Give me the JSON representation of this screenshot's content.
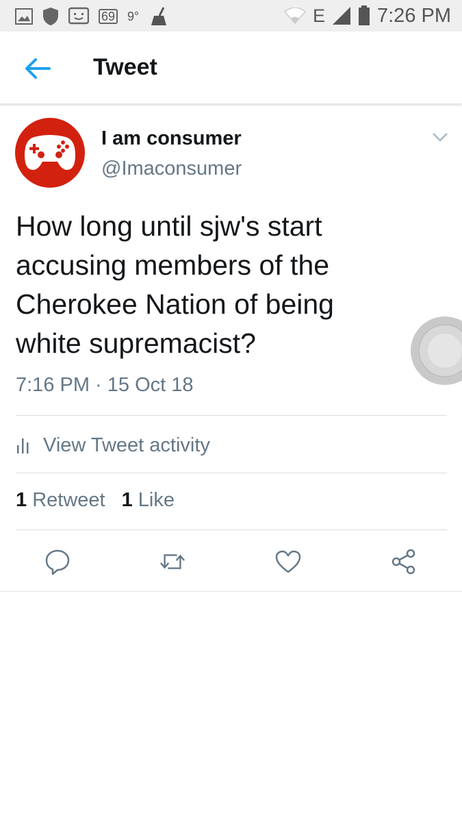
{
  "status_bar": {
    "badge_number": "69",
    "temperature": "9°",
    "network_label": "E",
    "time": "7:26 PM"
  },
  "app_bar": {
    "title": "Tweet"
  },
  "tweet": {
    "display_name": "I am consumer",
    "handle": "@Imaconsumer",
    "text": "How long until sjw's start\naccusing members of the\nCherokee Nation of being\nwhite supremacist?",
    "timestamp": "7:16 PM · 15 Oct 18",
    "activity_label": "View Tweet activity",
    "retweet_count": "1",
    "retweet_label": "Retweet",
    "like_count": "1",
    "like_label": "Like"
  },
  "icons": {
    "back": "back-arrow-icon",
    "caret": "chevron-down-icon",
    "activity": "bar-chart-icon",
    "reply": "reply-icon",
    "retweet": "retweet-icon",
    "like": "heart-icon",
    "share": "share-icon"
  },
  "colors": {
    "accent": "#1da1f2",
    "avatar_bg": "#d3210f",
    "text_primary": "#14171a",
    "text_secondary": "#657786",
    "status_bar_bg": "#efefef"
  }
}
